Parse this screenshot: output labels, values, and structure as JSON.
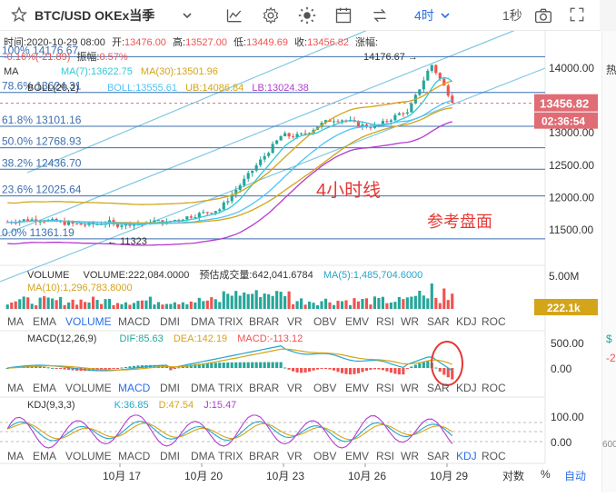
{
  "toolbar": {
    "title": "BTC/USD OKEx当季",
    "interval": "4时",
    "countdown_mode": "1秒"
  },
  "ohlc": {
    "time_label": "时间:",
    "time": "2020-10-29 08:00",
    "open_label": "开:",
    "open": "13476.00",
    "high_label": "高:",
    "high": "13527.00",
    "low_label": "低:",
    "low": "13449.69",
    "close_label": "收:",
    "close": "13456.82",
    "change_label": "涨幅:",
    "change_value": "-0.16%(-21.89)",
    "amplitude_label": "振幅:",
    "amplitude": "0.57%"
  },
  "ma_legend": {
    "ma_label": "MA",
    "ma7": "MA(7):13622.75",
    "ma30": "MA(30):13501.96"
  },
  "boll_legend": {
    "label": "BOLL(20,2)",
    "boll": "BOLL:13555.61",
    "ub": "UB:14086.84",
    "lb": "LB:13024.38"
  },
  "fib_levels": [
    {
      "label": "100% 14176.67",
      "value": 14176.67
    },
    {
      "label": "78.6% 13624.31",
      "value": 13624.31
    },
    {
      "label": "61.8% 13101.16",
      "value": 13101.16
    },
    {
      "label": "50.0% 12768.93",
      "value": 12768.93
    },
    {
      "label": "38.2% 12436.70",
      "value": 12436.7
    },
    {
      "label": "23.6% 12025.64",
      "value": 12025.64
    },
    {
      "label": "0.0% 11361.19",
      "value": 11361.19
    }
  ],
  "price_axis": {
    "ticks": [
      "14000.00",
      "13500.00",
      "13000.00",
      "12500.00",
      "12000.00",
      "11500.00"
    ],
    "current_price": "13456.82",
    "countdown": "02:36:54"
  },
  "annotations": {
    "high_marker": "14176.67",
    "low_marker": "11323",
    "timeframe_note": "4小时线",
    "reference_note": "参考盘面"
  },
  "volume": {
    "label": "VOLUME",
    "value": "VOLUME:222,084.0000",
    "estimate": "预估成交量:642,041.6784",
    "ma5": "MA(5):1,485,704.6000",
    "ma10": "MA(10):1,296,783.8000",
    "axis_top": "5.00M",
    "current_tag": "222.1k"
  },
  "indicator_tabs": [
    "MA",
    "EMA",
    "VOLUME",
    "MACD",
    "DMI",
    "DMA",
    "TRIX",
    "BRAR",
    "VR",
    "OBV",
    "EMV",
    "RSI",
    "WR",
    "SAR",
    "KDJ",
    "ROC"
  ],
  "macd": {
    "label": "MACD(12,26,9)",
    "dif": "DIF:85.63",
    "dea": "DEA:142.19",
    "macd": "MACD:-113.12",
    "axis": [
      "500.00",
      "0.00"
    ]
  },
  "kdj": {
    "label": "KDJ(9,3,3)",
    "k": "K:36.85",
    "d": "D:47.54",
    "j": "J:15.47",
    "axis": [
      "100.00",
      "0.00"
    ]
  },
  "time_axis": {
    "labels": [
      "10月 17",
      "10月 20",
      "10月 23",
      "10月 26",
      "10月 29"
    ],
    "log_label": "对数",
    "percent_label": "%",
    "auto_label": "自动"
  },
  "right_edge": {
    "t1": "热",
    "t2": "$",
    "t3": "-2",
    "t4": "600"
  },
  "colors": {
    "up": "#26a69a",
    "down": "#ef5350",
    "ma7": "#30c9d6",
    "ma30": "#d4a419",
    "boll_mid": "#4fc3f7",
    "boll_lb": "#b23bd1",
    "fib_line": "#3d6fb0",
    "channel": "#7ec8e3",
    "price_tag": "#e06c75",
    "annotation_red": "#e53935",
    "active_tab": "#2b6fe6"
  }
}
